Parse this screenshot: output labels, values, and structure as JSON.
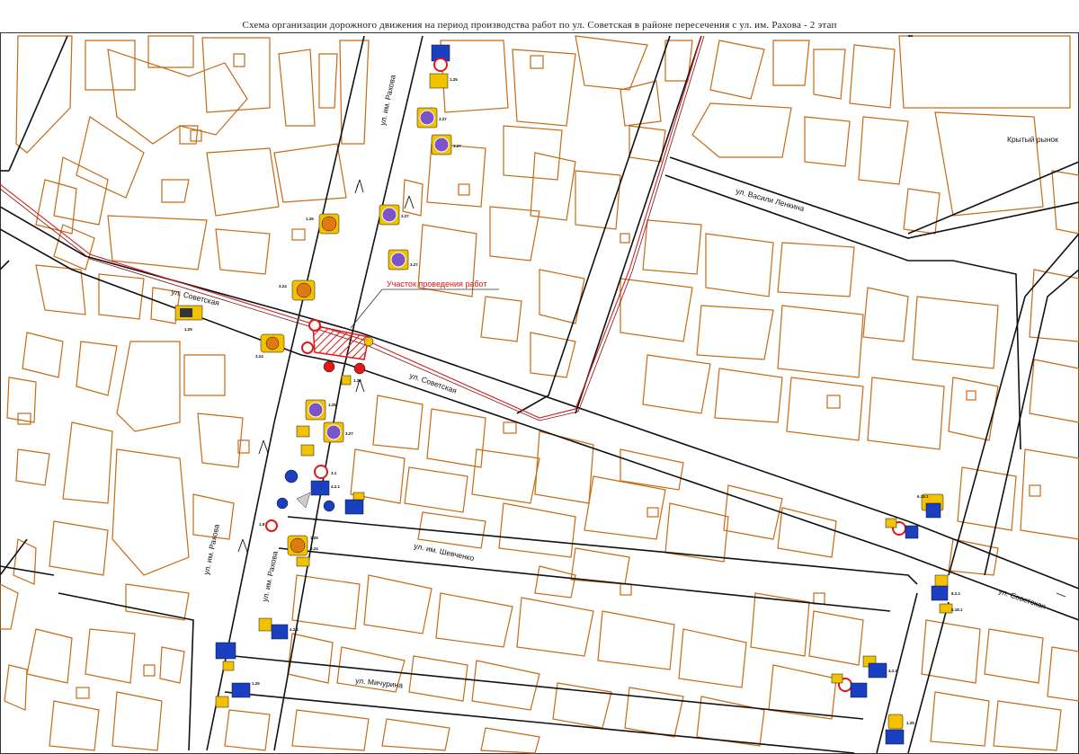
{
  "title": "Схема организации дорожного движения на период производства работ по ул. Советская в районе пересечения с ул. им.  Рахова - 2 этап",
  "work_zone_label": "Участок проведения работ",
  "streets": {
    "sovetskaya": "ул. Советская",
    "rakhova": "ул. им. Рахова",
    "lenkina": "ул. Васили Ленкина",
    "shevchenko": "ул. им. Шевченко",
    "michurina": "ул. Мичурина",
    "market": "Крытый рынок"
  },
  "sign_codes": [
    "1.25",
    "3.27",
    "3.24",
    "3.1",
    "4.2.1",
    "6.18.1",
    "5.19.1",
    "8.2.1",
    "8.22.1",
    "1.8",
    "4.1.1"
  ],
  "colors": {
    "building": "#c56a14",
    "road": "#111111",
    "tram_line": "#d42020",
    "work_zone": "#e01818",
    "sign_yellow": "#f2c200",
    "sign_blue": "#1a3fc0",
    "sign_red": "#e01818",
    "sign_purple": "#7b55c8"
  }
}
